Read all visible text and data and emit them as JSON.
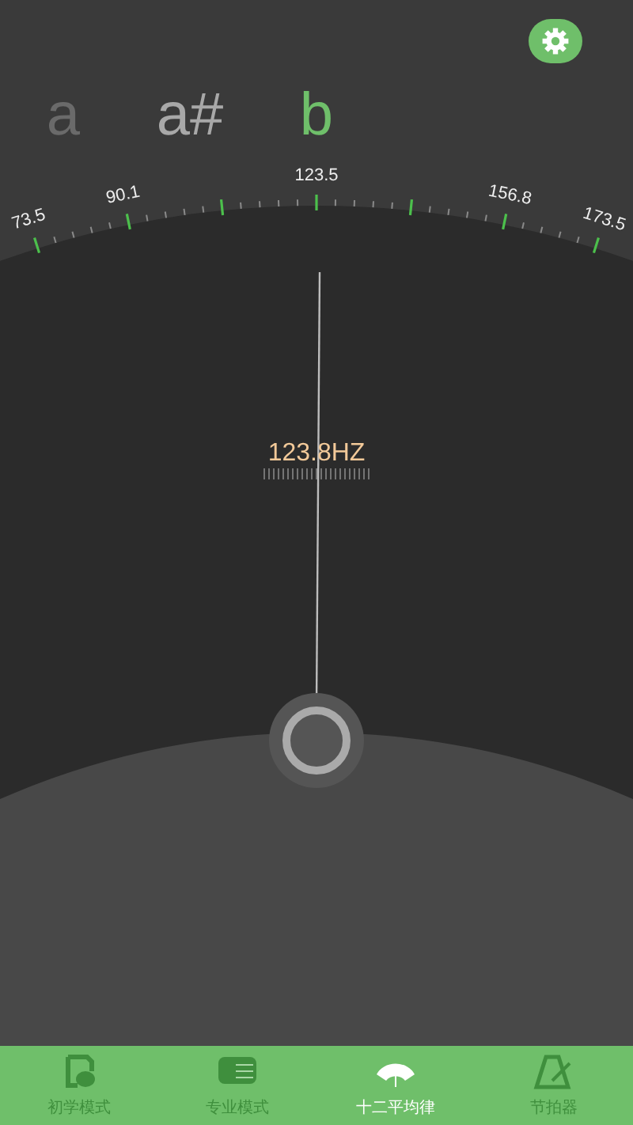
{
  "notes": [
    {
      "label": "a",
      "selected": false
    },
    {
      "label": "a#",
      "selected": false
    },
    {
      "label": "b",
      "selected": true
    }
  ],
  "scale": [
    {
      "kind": "labeled",
      "label": "73.5"
    },
    {
      "kind": "labeled",
      "label": "90.1"
    },
    {
      "kind": "plain"
    },
    {
      "kind": "labeled",
      "label": "123.5"
    },
    {
      "kind": "plain"
    },
    {
      "kind": "labeled",
      "label": "156.8"
    },
    {
      "kind": "labeled",
      "label": "173.5"
    }
  ],
  "frequency": "123.8HZ",
  "nav": [
    {
      "label": "初学模式",
      "kind": "leaf",
      "selected": false
    },
    {
      "label": "专业模式",
      "kind": "keys",
      "selected": false
    },
    {
      "label": "十二平均律",
      "kind": "arch",
      "selected": true
    },
    {
      "label": "节拍器",
      "kind": "metronome",
      "selected": false
    }
  ]
}
